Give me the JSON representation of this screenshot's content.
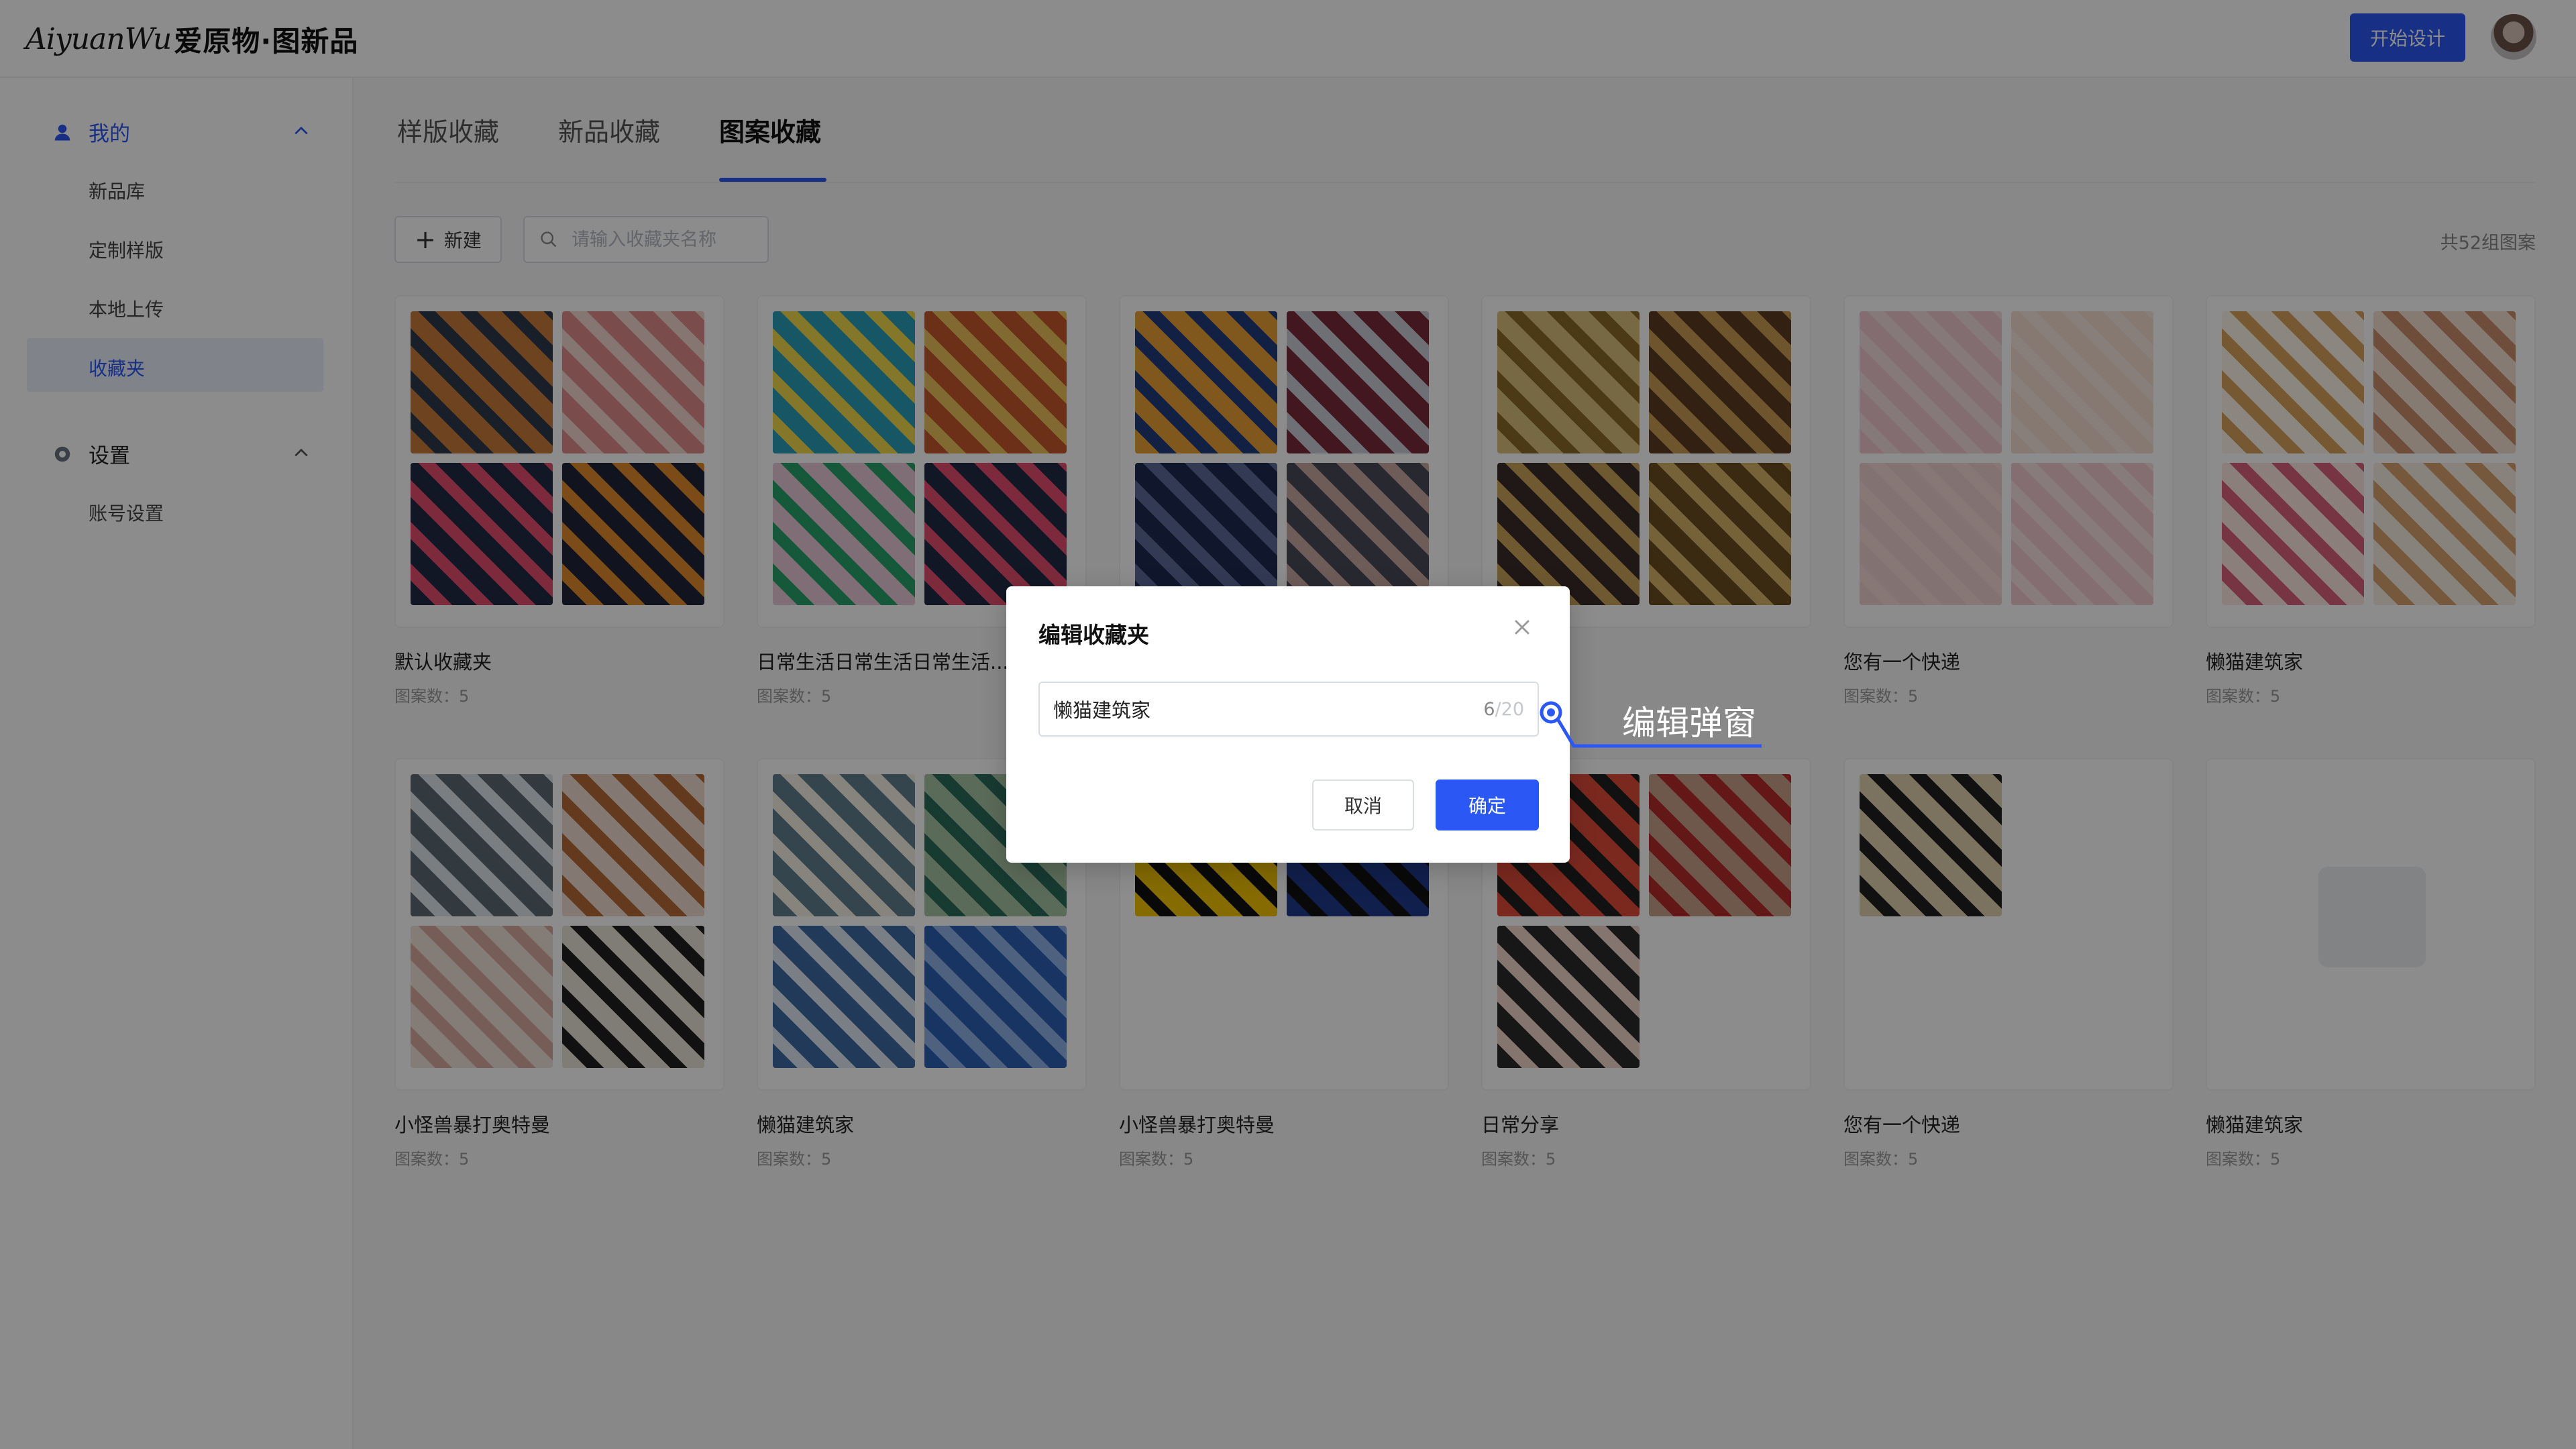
{
  "header": {
    "logo_script": "AiyuanWu",
    "logo_cn": "爱原物·图新品",
    "start_button": "开始设计"
  },
  "sidebar": {
    "group_mine": "我的",
    "items_mine": [
      "新品库",
      "定制样版",
      "本地上传",
      "收藏夹"
    ],
    "active_item": "收藏夹",
    "group_settings": "设置",
    "items_settings": [
      "账号设置"
    ]
  },
  "tabs": [
    "样版收藏",
    "新品收藏",
    "图案收藏"
  ],
  "active_tab": "图案收藏",
  "toolbar": {
    "new_label": "新建",
    "search_placeholder": "请输入收藏夹名称",
    "total": "共52组图案"
  },
  "cards": [
    {
      "title": "默认收藏夹",
      "count": "图案数：5"
    },
    {
      "title": "日常生活日常生活日常生活...",
      "count": "图案数：5"
    },
    {
      "title": "",
      "count": ""
    },
    {
      "title": "",
      "count": ""
    },
    {
      "title": "您有一个快递",
      "count": "图案数：5"
    },
    {
      "title": "懒猫建筑家",
      "count": "图案数：5"
    },
    {
      "title": "小怪兽暴打奥特曼",
      "count": "图案数：5"
    },
    {
      "title": "懒猫建筑家",
      "count": "图案数：5"
    },
    {
      "title": "小怪兽暴打奥特曼",
      "count": "图案数：5"
    },
    {
      "title": "日常分享",
      "count": "图案数：5"
    },
    {
      "title": "您有一个快递",
      "count": "图案数：5"
    },
    {
      "title": "懒猫建筑家",
      "count": "图案数：5"
    }
  ],
  "modal": {
    "title": "编辑收藏夹",
    "input_value": "懒猫建筑家",
    "char_current": "6",
    "char_max": "/20",
    "cancel": "取消",
    "confirm": "确定"
  },
  "annotation": "编辑弹窗",
  "colors": {
    "accent": "#2b58f4"
  }
}
